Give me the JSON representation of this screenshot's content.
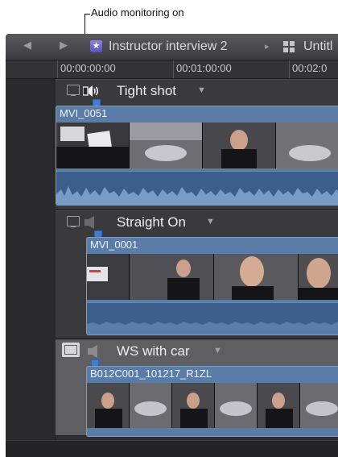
{
  "callout": {
    "text": "Audio monitoring on"
  },
  "titlebar": {
    "back_icon": "back-arrow-icon",
    "forward_icon": "forward-arrow-icon",
    "project_icon": "star-project-icon",
    "project_title": "Instructor interview 2",
    "separator": "▸",
    "grid_icon": "grid-icon",
    "second_title": "Untitl"
  },
  "ruler": {
    "timecodes": [
      "00:00:00:00",
      "00:01:00:00",
      "00:02:0"
    ]
  },
  "auditions": [
    {
      "label": "Tight shot",
      "monitoring": true,
      "dropdown": "▼",
      "clip": {
        "name": "MVI_0051"
      }
    },
    {
      "label": "Straight On",
      "monitoring": false,
      "dropdown": "▼",
      "clip": {
        "name": "MVI_0001"
      }
    },
    {
      "label": "WS with car",
      "monitoring": false,
      "dropdown": "▼",
      "clip": {
        "name": "B012C001_101217_R1ZL"
      }
    }
  ],
  "colors": {
    "clip_blue": "#5b7ca6",
    "waveform_blue": "#3c5e8a",
    "playhead_marker": "#3e7fd1"
  }
}
